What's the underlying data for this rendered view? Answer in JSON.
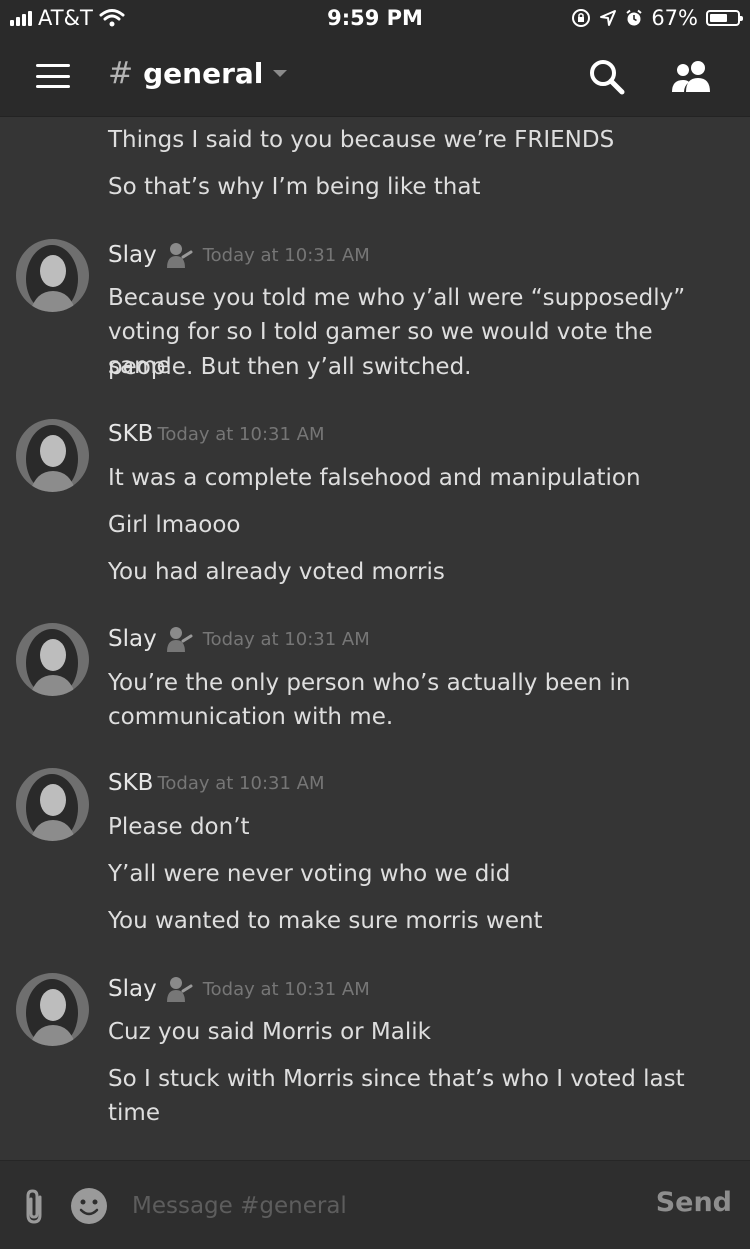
{
  "status": {
    "carrier": "AT&T",
    "time": "9:59 PM",
    "battery": "67%",
    "battery_level": 0.67
  },
  "header": {
    "hash": "#",
    "channel": "general"
  },
  "messages": {
    "continued": [
      "Things I said to you because we’re FRIENDS",
      "So that’s why I’m being like that"
    ],
    "groups": [
      {
        "author": "Slay",
        "timestamp": "Today at 10:31 AM",
        "lines": [
          "Because you told me who y’all were “supposedly”",
          "voting for so I told gamer so we would vote the same",
          "people. But then y’all switched."
        ]
      },
      {
        "author": "SKB",
        "timestamp": "Today at 10:31 AM",
        "lines": [
          "It was a complete falsehood and manipulation",
          "Girl lmaooo",
          "You had already voted morris"
        ]
      },
      {
        "author": "Slay",
        "timestamp": "Today at 10:31 AM",
        "lines": [
          "You’re the only person who’s actually been in",
          "communication with me."
        ]
      },
      {
        "author": "SKB",
        "timestamp": "Today at 10:31 AM",
        "lines": [
          "Please don’t",
          "Y’all were never voting who we did",
          "You wanted to make sure morris went"
        ]
      },
      {
        "author": "Slay",
        "timestamp": "Today at 10:31 AM",
        "lines": [
          "Cuz you said Morris or Malik",
          "So I stuck with Morris since that’s who I voted last",
          "time"
        ]
      }
    ]
  },
  "input": {
    "placeholder": "Message #general",
    "send_label": "Send"
  }
}
